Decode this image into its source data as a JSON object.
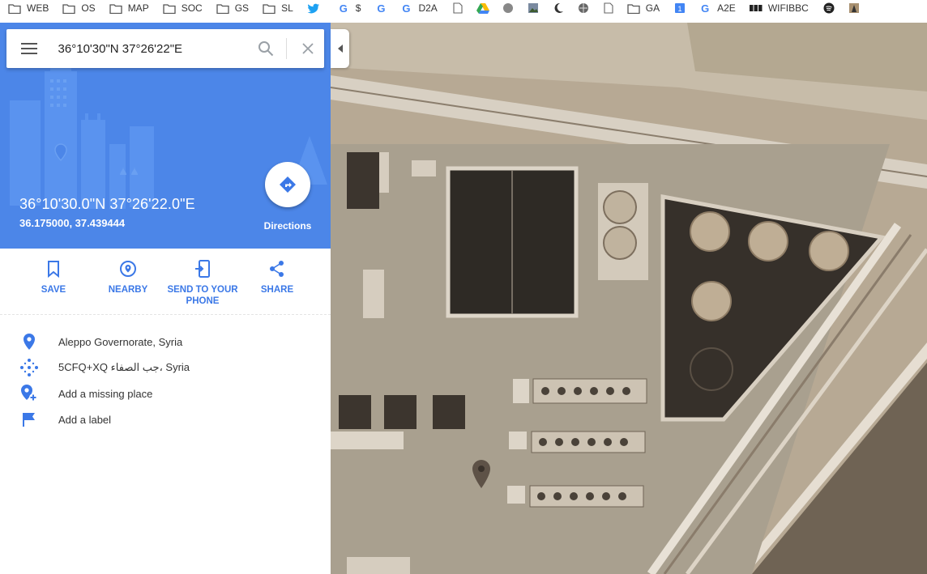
{
  "bookmarks": [
    {
      "label": "WEB",
      "icon": "folder-icon"
    },
    {
      "label": "OS",
      "icon": "folder-icon"
    },
    {
      "label": "MAP",
      "icon": "folder-icon"
    },
    {
      "label": "SOC",
      "icon": "folder-icon"
    },
    {
      "label": "GS",
      "icon": "folder-icon"
    },
    {
      "label": "SL",
      "icon": "folder-icon"
    },
    {
      "label": "",
      "icon": "twitter-icon"
    },
    {
      "label": "$",
      "icon": "google-icon"
    },
    {
      "label": "",
      "icon": "google-icon"
    },
    {
      "label": "D2A",
      "icon": "google-icon"
    },
    {
      "label": "",
      "icon": "page-icon"
    },
    {
      "label": "",
      "icon": "drive-icon"
    },
    {
      "label": "",
      "icon": "circle-icon"
    },
    {
      "label": "",
      "icon": "photo-icon"
    },
    {
      "label": "",
      "icon": "moon-icon"
    },
    {
      "label": "",
      "icon": "ball-icon"
    },
    {
      "label": "",
      "icon": "page-icon"
    },
    {
      "label": "GA",
      "icon": "folder-icon"
    },
    {
      "label": "",
      "icon": "calendar-icon"
    },
    {
      "label": "A2E",
      "icon": "google-icon"
    },
    {
      "label": "WIFIBBC",
      "icon": "bbc-icon"
    },
    {
      "label": "",
      "icon": "spotify-icon"
    },
    {
      "label": "",
      "icon": "image-icon"
    }
  ],
  "search": {
    "value": "36°10'30\"N 37°26'22\"E"
  },
  "place": {
    "title": "36°10'30.0\"N 37°26'22.0\"E",
    "decimal": "36.175000, 37.439444",
    "directions_label": "Directions"
  },
  "actions": [
    {
      "label": "SAVE",
      "icon": "bookmark-icon"
    },
    {
      "label": "NEARBY",
      "icon": "nearby-icon"
    },
    {
      "label": "SEND TO YOUR PHONE",
      "icon": "send-to-phone-icon"
    },
    {
      "label": "SHARE",
      "icon": "share-icon"
    }
  ],
  "info_rows": [
    {
      "text": "Aleppo Governorate, Syria",
      "icon": "location-pin-icon"
    },
    {
      "text": "5CFQ+XQ جب الصفاء، Syria",
      "icon": "plus-code-icon"
    },
    {
      "text": "Add a missing place",
      "icon": "add-place-icon"
    },
    {
      "text": "Add a label",
      "icon": "flag-icon"
    }
  ],
  "colors": {
    "accent": "#4c86e8",
    "action_blue": "#3b78e7",
    "map_base": "#b9ab96"
  }
}
